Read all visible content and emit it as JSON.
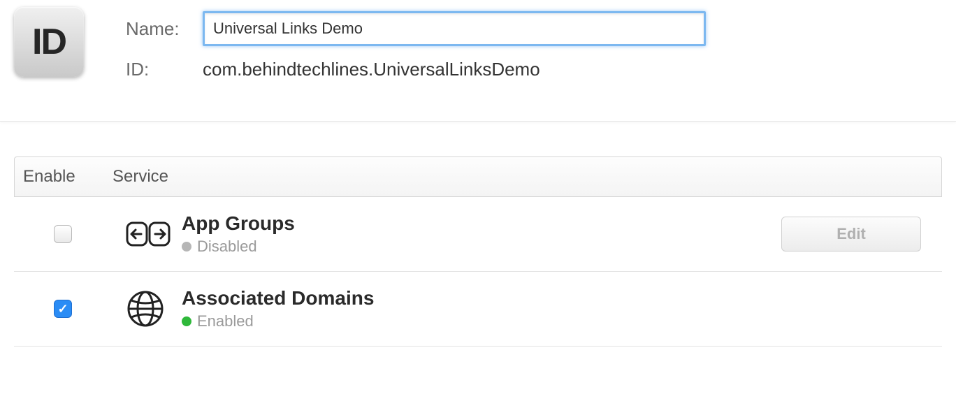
{
  "header": {
    "icon_label": "ID",
    "name_label": "Name:",
    "name_value": "Universal Links Demo",
    "id_label": "ID:",
    "id_value": "com.behindtechlines.UniversalLinksDemo"
  },
  "table": {
    "headers": {
      "enable": "Enable",
      "service": "Service"
    },
    "services": [
      {
        "enabled": false,
        "icon": "app-groups-icon",
        "name": "App Groups",
        "status_text": "Disabled",
        "status_color": "grey",
        "edit_label": "Edit",
        "show_edit": true
      },
      {
        "enabled": true,
        "icon": "associated-domains-icon",
        "name": "Associated Domains",
        "status_text": "Enabled",
        "status_color": "green",
        "show_edit": false
      }
    ]
  }
}
